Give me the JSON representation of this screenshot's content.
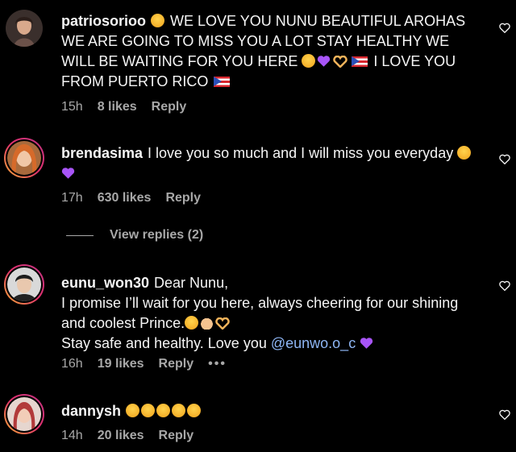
{
  "comments": [
    {
      "username": "patriosorioo",
      "text_a": "WE LOVE YOU NUNU BEAUTIFUL AROHAS WE ARE GOING TO MISS YOU A LOT STAY HEALTHY WE WILL BE WAITING FOR YOU HERE",
      "text_b": "I LOVE YOU FROM PUERTO RICO",
      "time": "15h",
      "likes": "8 likes",
      "reply": "Reply"
    },
    {
      "username": "brendasima",
      "text_a": "I love you so much and I will miss you everyday",
      "time": "17h",
      "likes": "630 likes",
      "reply": "Reply"
    },
    {
      "username": "eunu_won30",
      "text_a": "Dear Nunu,",
      "text_b": "I promise I’ll wait for you here, always cheering for our shining and coolest Prince.",
      "text_c": "Stay safe and healthy. Love you",
      "mention": "@eunwo.o_c",
      "time": "16h",
      "likes": "19 likes",
      "reply": "Reply",
      "more": "•••"
    },
    {
      "username": "dannysh",
      "time": "14h",
      "likes": "20 likes",
      "reply": "Reply"
    }
  ],
  "view_replies": "View replies (2)",
  "colors": {
    "background": "#000000",
    "text": "#f5f5f5",
    "muted": "#a8a8a8",
    "mention": "#8eb6f5"
  }
}
